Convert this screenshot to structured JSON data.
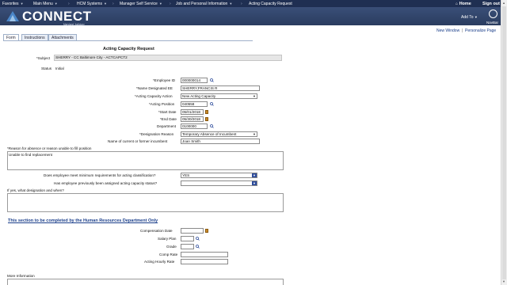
{
  "topnav": {
    "favorites": "Favorites",
    "main_menu": "Main Menu",
    "breadcrumb": [
      "HCM Systems",
      "Manager Self Service",
      "Job and Personal Information",
      "Acting Capacity Request"
    ],
    "home": "Home",
    "signout": "Sign out"
  },
  "banner": {
    "logo": "CONNECT",
    "logo_sub": "Maryland Judiciary",
    "add_to": "Add To",
    "navbar": "NavBar"
  },
  "links": {
    "new_window": "New Window",
    "personalize_page": "Personalize Page"
  },
  "tabs": [
    "Form",
    "Instructions",
    "Attachments"
  ],
  "form": {
    "title": "Acting Capacity Request",
    "subject_label": "*Subject",
    "subject_value": "SHERRY - CC Baltimore City - ACTCAPCT2",
    "status_label": "Status",
    "status_value": "Initial",
    "employee_id_label": "*Employee ID",
    "employee_id_value": "000000014",
    "name_label": "*Name Designated EE",
    "name_value": "SHERRY,FRANCIS R",
    "action_label": "*Acting Capacity Action",
    "action_value": "New Acting Capacity",
    "position_label": "*Acting Position",
    "position_value": "040558",
    "start_label": "*Start Date",
    "start_value": "05/01/2018",
    "end_label": "*End Date",
    "end_value": "05/30/2018",
    "dept_label": "Department",
    "dept_value": "0100000",
    "reason_label": "*Designation Reason",
    "reason_value": "Temporary Absence of Incumbent",
    "incumbent_label": "Name of current or former incumbent",
    "incumbent_value": "Joan Smith",
    "absence_label": "*Reason for absence or reason unable to fill position",
    "absence_value": "Unable to find replacement",
    "meets_label": "Does employee meet minimum requirements for acting classification?",
    "meets_value": "YES",
    "assigned_label": "Has employee previously been assigned acting capacity status?",
    "assigned_value": "",
    "ifyes_label": "If yes, what designation and when?",
    "ifyes_value": ""
  },
  "hr": {
    "link": "This section to be completed by the Human Resources Department Only",
    "comp_date": "Compensation Date",
    "salary_plan": "Salary Plan",
    "grade": "Grade",
    "comp_rate": "Comp Rate",
    "hourly_rate": "Acting Hourly Rate",
    "more_info": "More Information"
  }
}
